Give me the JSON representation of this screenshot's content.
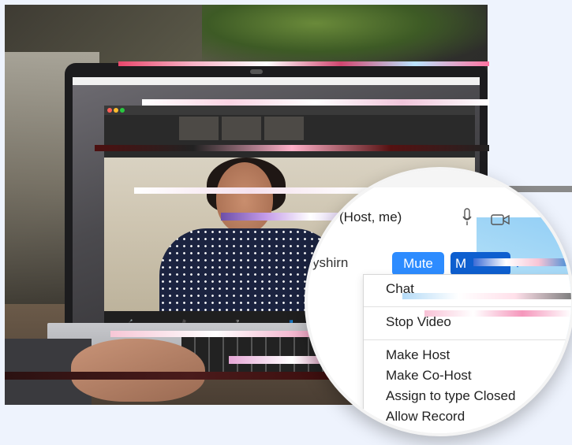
{
  "colors": {
    "accent": "#2d8cff",
    "accent_dark": "#0e5fcf",
    "share_screen": "#2fd45a",
    "background": "#eef3fd"
  },
  "icons": [
    "microphone-icon",
    "video-camera-icon",
    "chevron-down-icon"
  ],
  "magnified": {
    "participant_me": "(Host, me)",
    "participant_other": "yshirn",
    "mute_button": "Mute",
    "more_button": "M",
    "menu": {
      "chat": "Chat",
      "stop_video": "Stop Video",
      "make_host": "Make Host",
      "make_cohost": "Make Co-Host",
      "assign_type": "Assign to type Closed",
      "allow_record": "Allow Record"
    }
  }
}
